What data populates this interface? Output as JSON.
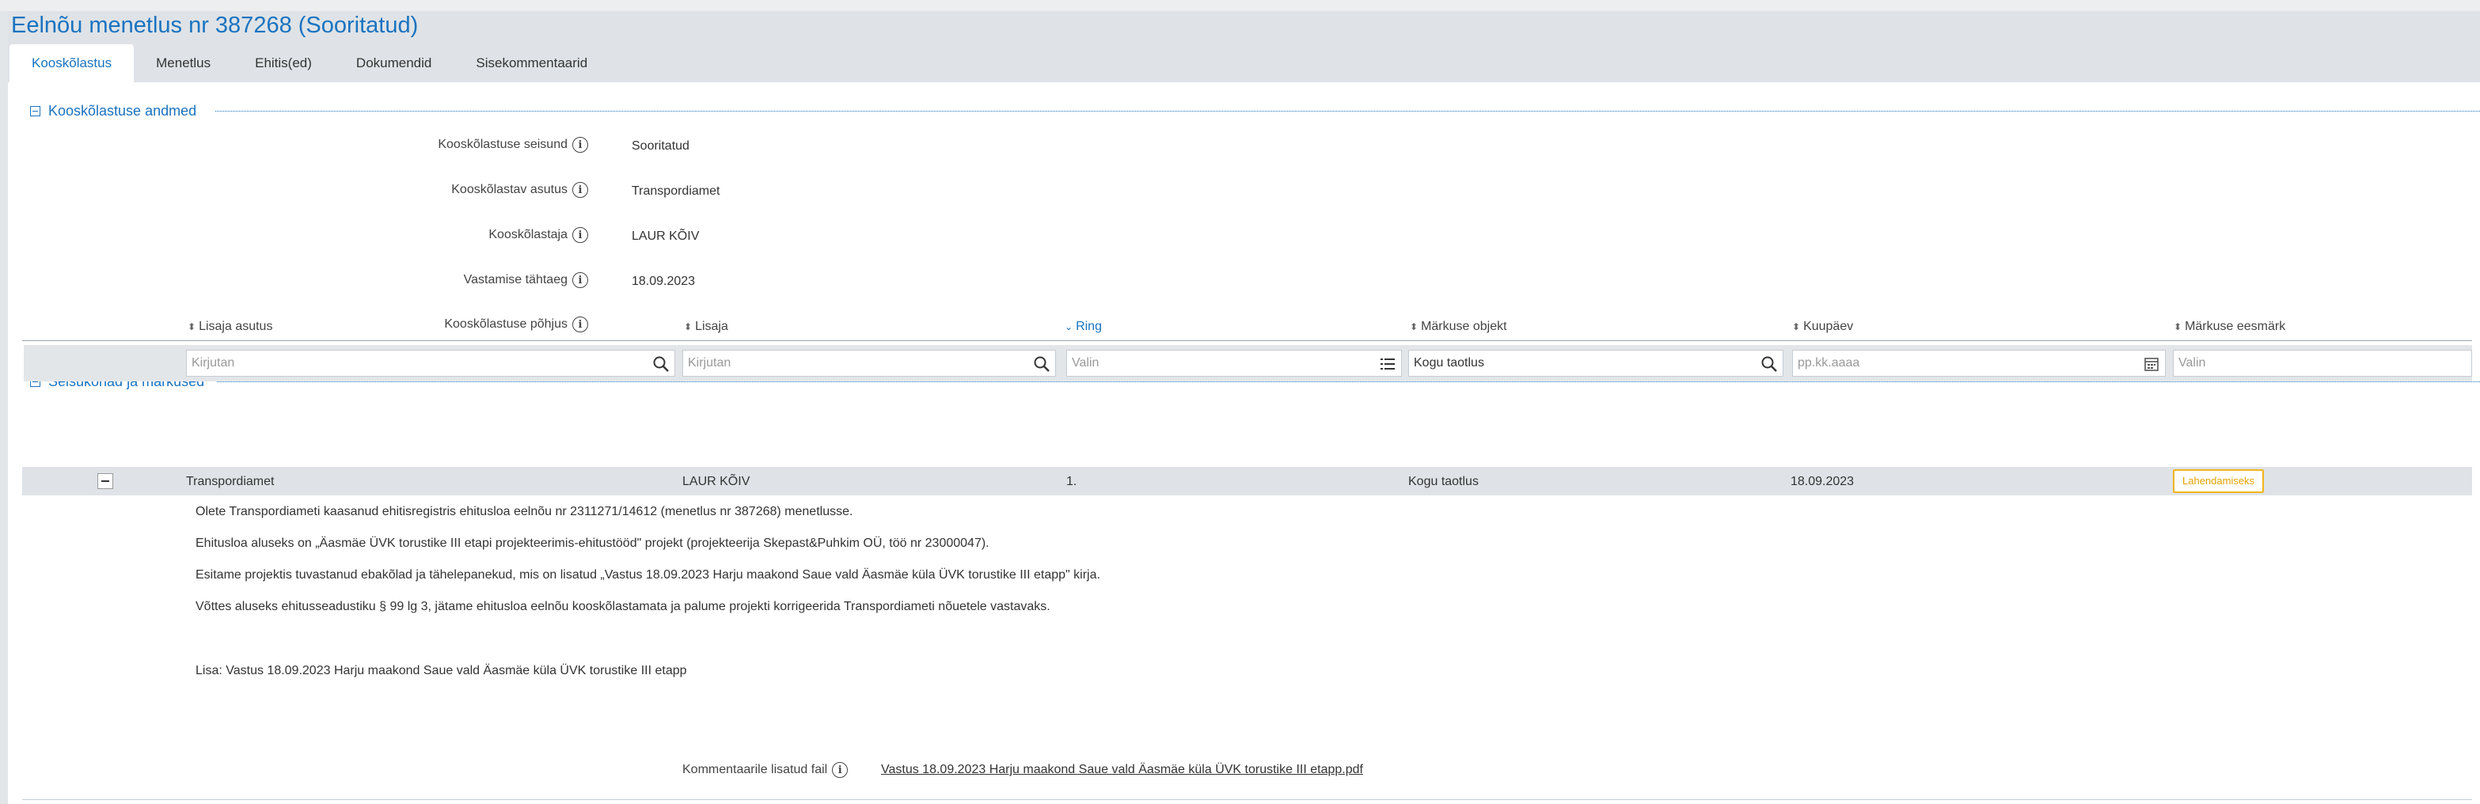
{
  "page": {
    "title": "Eelnõu menetlus nr 387268 (Sooritatud)"
  },
  "tabs": [
    {
      "label": "Kooskõlastus",
      "active": true
    },
    {
      "label": "Menetlus",
      "active": false
    },
    {
      "label": "Ehitis(ed)",
      "active": false
    },
    {
      "label": "Dokumendid",
      "active": false
    },
    {
      "label": "Sisekommentaarid",
      "active": false
    }
  ],
  "section1": {
    "title": "Kooskõlastuse andmed",
    "fields": [
      {
        "label": "Kooskõlastuse seisund",
        "value": "Sooritatud"
      },
      {
        "label": "Kooskõlastav asutus",
        "value": "Transpordiamet"
      },
      {
        "label": "Kooskõlastaja",
        "value": "LAUR KÕIV"
      },
      {
        "label": "Vastamise tähtaeg",
        "value": "18.09.2023"
      },
      {
        "label": "Kooskõlastuse põhjus",
        "value": ""
      }
    ]
  },
  "section2": {
    "title": "Seisukohad ja märkused",
    "columns": [
      {
        "label": "Lisaja asutus"
      },
      {
        "label": "Lisaja"
      },
      {
        "label": "Ring"
      },
      {
        "label": "Märkuse objekt"
      },
      {
        "label": "Kuupäev"
      },
      {
        "label": "Märkuse eesmärk"
      }
    ],
    "filters": {
      "lisaja_asutus": {
        "placeholder": "Kirjutan"
      },
      "lisaja": {
        "placeholder": "Kirjutan"
      },
      "ring": {
        "placeholder": "Valin"
      },
      "markuse_objekt": {
        "value": "Kogu taotlus"
      },
      "kuupaev": {
        "placeholder": "pp.kk.aaaa"
      },
      "markuse_eesmark": {
        "placeholder": "Valin"
      }
    },
    "row": {
      "lisaja_asutus": "Transpordiamet",
      "lisaja": "LAUR KÕIV",
      "ring": "1.",
      "markuse_objekt": "Kogu taotlus",
      "kuupaev": "18.09.2023",
      "markuse_eesmark": "Lahendamiseks"
    },
    "comment_lines": [
      "Olete Transpordiameti kaasanud ehitisregistris ehitusloa eelnõu nr 2311271/14612 (menetlus nr 387268) menetlusse.",
      "Ehitusloa aluseks on „Äasmäe ÜVK torustike III etapi projekteerimis-ehitustööd\" projekt (projekteerija Skepast&Puhkim OÜ, töö nr 23000047).",
      "Esitame projektis tuvastanud ebakõlad ja tähelepanekud, mis on lisatud „Vastus 18.09.2023 Harju maakond Saue vald Äasmäe küla ÜVK torustike III etapp\" kirja.",
      "Võttes aluseks ehitusseadustiku § 99 lg 3, jätame ehitusloa eelnõu kooskõlastamata ja palume projekti korrigeerida Transpordiameti nõuetele vastavaks.",
      "Lisa: Vastus 18.09.2023 Harju maakond Saue vald Äasmäe küla ÜVK torustike III etapp"
    ],
    "attachment": {
      "label": "Kommentaarile lisatud fail",
      "file": "Vastus 18.09.2023 Harju maakond Saue vald Äasmäe küla ÜVK torustike III etapp.pdf"
    }
  },
  "colors": {
    "accent": "#1a73c0",
    "header_bg": "#dfe3e7",
    "badge_border": "#f2b51d"
  }
}
